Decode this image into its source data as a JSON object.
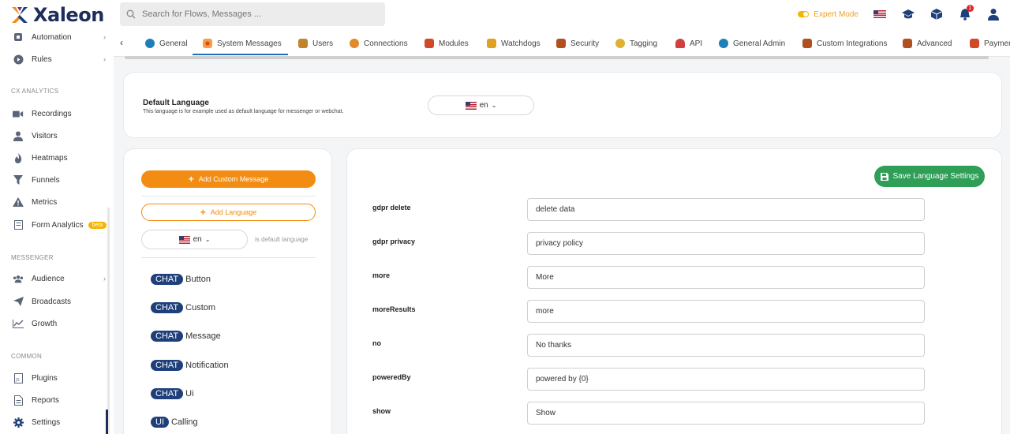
{
  "app": {
    "name": "Xaleon"
  },
  "search": {
    "placeholder": "Search for Flows, Messages ..."
  },
  "topbar": {
    "expert_mode_label": "Expert Mode",
    "notification_count": "1"
  },
  "sidebar": {
    "items_top": [
      {
        "label": "Automation",
        "icon": "automation-icon",
        "has_chevron": true
      },
      {
        "label": "Rules",
        "icon": "rules-icon",
        "has_chevron": true
      }
    ],
    "sections": [
      {
        "title": "CX ANALYTICS",
        "items": [
          {
            "label": "Recordings",
            "icon": "video-icon"
          },
          {
            "label": "Visitors",
            "icon": "user-icon"
          },
          {
            "label": "Heatmaps",
            "icon": "flame-icon"
          },
          {
            "label": "Funnels",
            "icon": "funnel-icon"
          },
          {
            "label": "Metrics",
            "icon": "warning-icon"
          },
          {
            "label": "Form Analytics",
            "icon": "form-icon",
            "badge": "beta"
          }
        ]
      },
      {
        "title": "MESSENGER",
        "items": [
          {
            "label": "Audience",
            "icon": "users-icon",
            "has_chevron": true
          },
          {
            "label": "Broadcasts",
            "icon": "send-icon"
          },
          {
            "label": "Growth",
            "icon": "chart-line-icon"
          }
        ]
      },
      {
        "title": "COMMON",
        "items": [
          {
            "label": "Plugins",
            "icon": "plugin-icon"
          },
          {
            "label": "Reports",
            "icon": "report-icon"
          },
          {
            "label": "Settings",
            "icon": "gear-icon"
          }
        ]
      }
    ]
  },
  "tabs": [
    {
      "label": "General",
      "icon": "globe-icon",
      "color": "#1e7fb8"
    },
    {
      "label": "System Messages",
      "icon": "grid-icon",
      "color": "#e0452c",
      "active": true
    },
    {
      "label": "Users",
      "icon": "users-icon",
      "color": "#c0842a"
    },
    {
      "label": "Connections",
      "icon": "connections-icon",
      "color": "#e08a2a"
    },
    {
      "label": "Modules",
      "icon": "modules-icon",
      "color": "#d04a2a"
    },
    {
      "label": "Watchdogs",
      "icon": "watchdog-icon",
      "color": "#e0a020"
    },
    {
      "label": "Security",
      "icon": "security-icon",
      "color": "#b05020"
    },
    {
      "label": "Tagging",
      "icon": "tag-icon",
      "color": "#e0b030"
    },
    {
      "label": "API",
      "icon": "api-icon",
      "color": "#d04040"
    },
    {
      "label": "General Admin",
      "icon": "globe-icon",
      "color": "#1e7fb8"
    },
    {
      "label": "Custom Integrations",
      "icon": "integration-icon",
      "color": "#b05020"
    },
    {
      "label": "Advanced",
      "icon": "advanced-icon",
      "color": "#b05020"
    },
    {
      "label": "Paymen",
      "icon": "payment-icon",
      "color": "#d04a2a"
    }
  ],
  "default_language": {
    "title": "Default Language",
    "description": "This language is for example used as default language for messenger or webchat.",
    "value": "en"
  },
  "left_panel": {
    "add_custom_message_label": "Add Custom Message",
    "add_language_label": "Add Language",
    "language_value": "en",
    "default_note": "is default language",
    "categories": [
      {
        "badge": "CHAT",
        "label": "Button"
      },
      {
        "badge": "CHAT",
        "label": "Custom"
      },
      {
        "badge": "CHAT",
        "label": "Message"
      },
      {
        "badge": "CHAT",
        "label": "Notification"
      },
      {
        "badge": "CHAT",
        "label": "Ui"
      },
      {
        "badge": "UI",
        "label": "Calling"
      }
    ]
  },
  "right_panel": {
    "save_label": "Save Language Settings",
    "fields": [
      {
        "key": "gdpr delete",
        "value": "delete data"
      },
      {
        "key": "gdpr privacy",
        "value": "privacy policy"
      },
      {
        "key": "more",
        "value": "More"
      },
      {
        "key": "moreResults",
        "value": "more"
      },
      {
        "key": "no",
        "value": "No thanks"
      },
      {
        "key": "poweredBy",
        "value": "powered by {0}"
      },
      {
        "key": "show",
        "value": "Show"
      }
    ]
  }
}
